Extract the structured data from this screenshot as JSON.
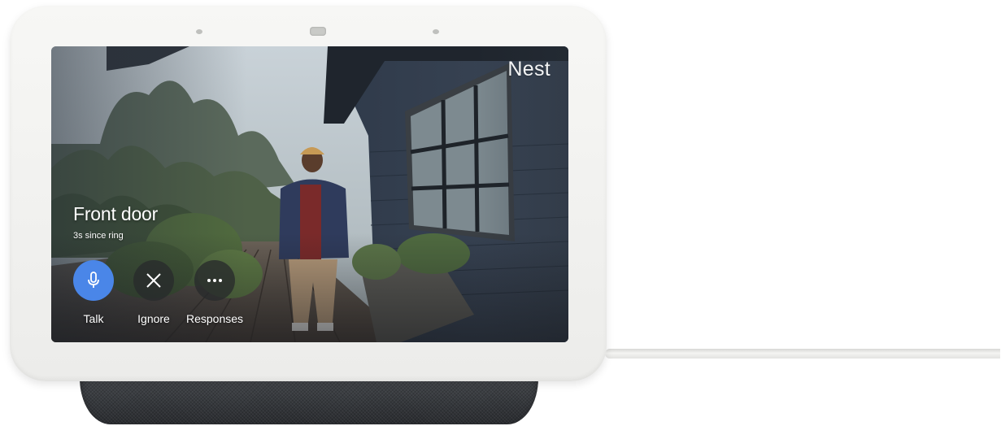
{
  "device": {
    "brand": "Nest"
  },
  "screen": {
    "title": "Front door",
    "subtitle": "3s since ring"
  },
  "actions": [
    {
      "label": "Talk",
      "icon": "microphone-icon",
      "color": "#4a86e8"
    },
    {
      "label": "Ignore",
      "icon": "close-icon",
      "color": "#2a2c2e"
    },
    {
      "label": "Responses",
      "icon": "more-horizontal-icon",
      "color": "#2a2c2e"
    }
  ],
  "colors": {
    "bezel": "#f2f2f0",
    "speaker_fabric": "#3b3e42",
    "accent": "#4a86e8"
  }
}
